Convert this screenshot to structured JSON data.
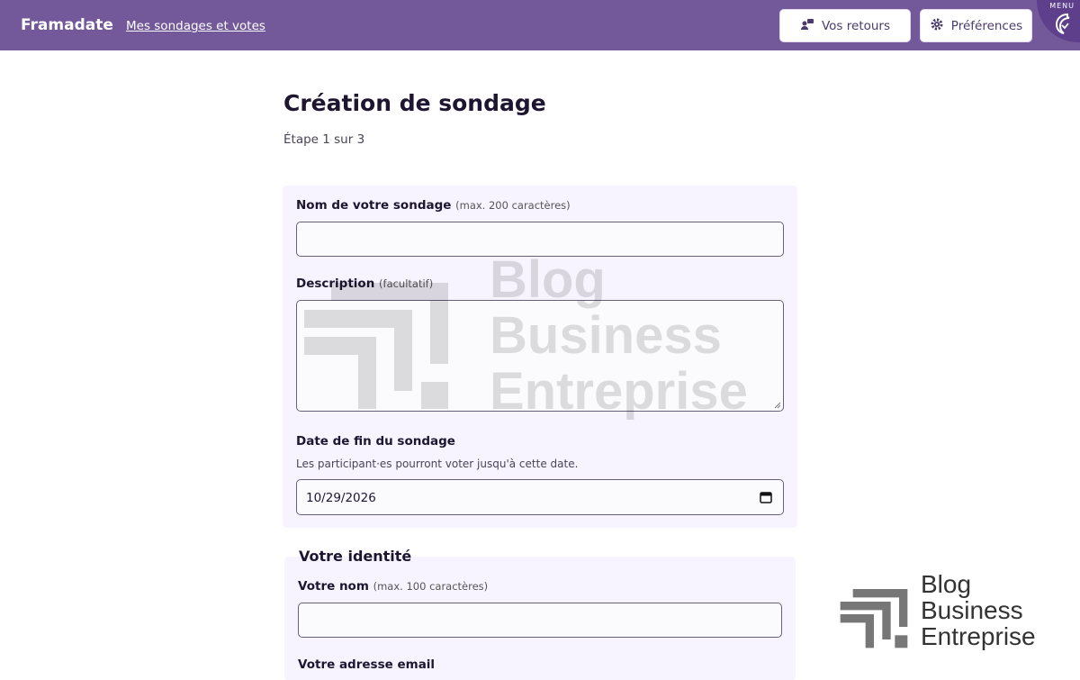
{
  "header": {
    "brand": "Framadate",
    "nav_link": "Mes sondages et votes",
    "feedback_button": "Vos retours",
    "preferences_button": "Préférences",
    "menu_label": "MENU"
  },
  "page": {
    "title": "Création de sondage",
    "step": "Étape 1 sur 3"
  },
  "form": {
    "poll_name": {
      "label": "Nom de votre sondage",
      "hint": "(max. 200 caractères)",
      "value": ""
    },
    "description": {
      "label": "Description",
      "hint": "(facultatif)",
      "value": ""
    },
    "end_date": {
      "label": "Date de fin du sondage",
      "help": "Les participant·es pourront voter jusqu'à cette date.",
      "value": "10/29/2026"
    }
  },
  "identity": {
    "title": "Votre identité",
    "name": {
      "label": "Votre nom",
      "hint": "(max. 100 caractères)",
      "value": ""
    },
    "email": {
      "label": "Votre adresse email"
    }
  },
  "watermark": {
    "line1": "Blog",
    "line2": "Business",
    "line3": "Entreprise"
  },
  "colors": {
    "header_bg": "#735999",
    "card_bg": "#f7f4ff",
    "title": "#1e1530"
  }
}
